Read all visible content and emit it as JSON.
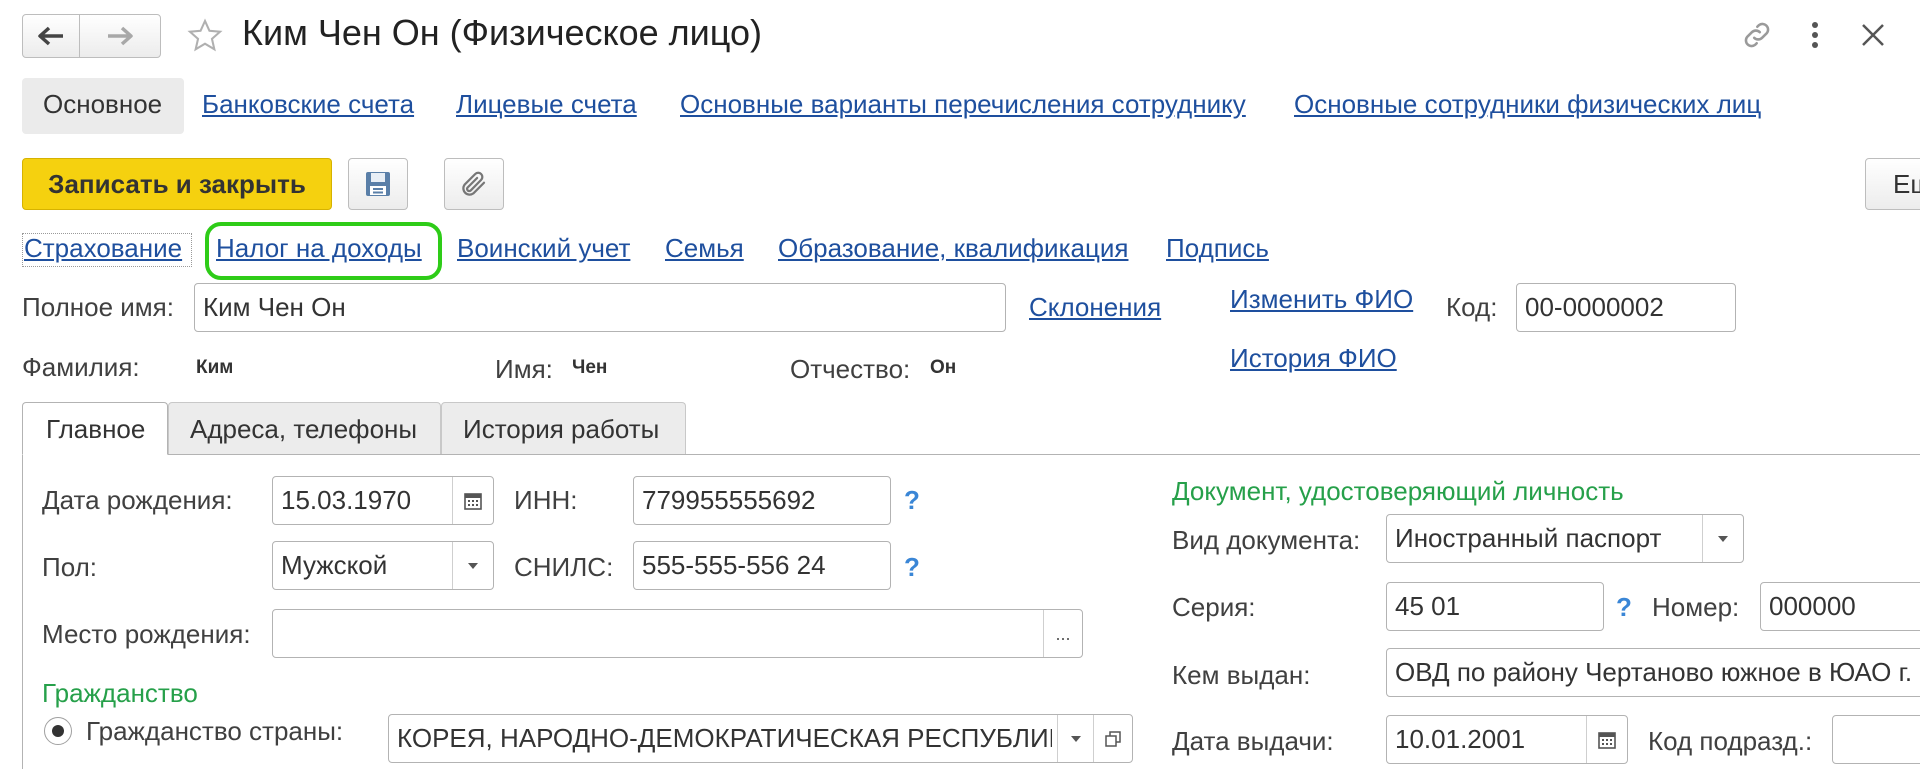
{
  "window": {
    "title": "Ким Чен Он (Физическое лицо)",
    "back_icon": "arrow-left-icon",
    "forward_icon": "arrow-right-icon",
    "star_icon": "star-icon",
    "link_icon": "link-icon",
    "menu_icon": "more-vertical-icon",
    "close_icon": "close-icon"
  },
  "nav_tabs": [
    {
      "label": "Основное",
      "active": true
    },
    {
      "label": "Банковские счета"
    },
    {
      "label": "Лицевые счета"
    },
    {
      "label": "Основные варианты перечисления сотруднику"
    },
    {
      "label": "Основные сотрудники физических лиц"
    }
  ],
  "toolbar": {
    "save_close_label": "Записать и закрыть",
    "save_icon": "floppy-disk-icon",
    "attach_icon": "paperclip-icon",
    "more_label": "Ещ"
  },
  "sections": [
    {
      "label": "Страхование"
    },
    {
      "label": "Налог на доходы",
      "highlighted": true
    },
    {
      "label": "Воинский учет"
    },
    {
      "label": "Семья"
    },
    {
      "label": "Образование, квалификация"
    },
    {
      "label": "Подпись"
    }
  ],
  "name": {
    "full_name_label": "Полное имя:",
    "full_name_value": "Ким Чен Он",
    "declensions_link": "Склонения",
    "change_fio_link": "Изменить ФИО",
    "history_fio_link": "История ФИО",
    "code_label": "Код:",
    "code_value": "00-0000002",
    "surname_label": "Фамилия:",
    "surname_value": "Ким",
    "first_name_label": "Имя:",
    "first_name_value": "Чен",
    "patronymic_label": "Отчество:",
    "patronymic_value": "Он"
  },
  "inner_tabs": [
    {
      "label": "Главное",
      "active": true
    },
    {
      "label": "Адреса, телефоны"
    },
    {
      "label": "История работы"
    }
  ],
  "main": {
    "birth_date_label": "Дата рождения:",
    "birth_date_value": "15.03.1970",
    "inn_label": "ИНН:",
    "inn_value": "779955555692",
    "gender_label": "Пол:",
    "gender_value": "Мужской",
    "snils_label": "СНИЛС:",
    "snils_value": "555-555-556 24",
    "help_mark": "?",
    "birth_place_label": "Место рождения:",
    "birth_place_value": "",
    "select_button": "...",
    "citizenship_header": "Гражданство",
    "citizenship_option_label": "Гражданство страны:",
    "citizenship_value": "КОРЕЯ, НАРОДНО-ДЕМОКРАТИЧЕСКАЯ РЕСПУБЛИКА"
  },
  "document": {
    "header": "Документ, удостоверяющий личность",
    "doc_type_label": "Вид документа:",
    "doc_type_value": "Иностранный паспорт",
    "series_label": "Серия:",
    "series_value": "45 01",
    "number_label": "Номер:",
    "number_value": "000000",
    "issued_by_label": "Кем выдан:",
    "issued_by_value": "ОВД по району Чертаново южное в ЮАО г. Москвы",
    "issue_date_label": "Дата выдачи:",
    "issue_date_value": "10.01.2001",
    "dept_code_label": "Код подразд.:",
    "dept_code_value": ""
  },
  "colors": {
    "accent_yellow": "#f5d10f",
    "link_blue": "#1e4f9e",
    "section_green": "#26a04a",
    "highlight_green": "#2ecc18",
    "help_blue": "#3a86d6"
  }
}
